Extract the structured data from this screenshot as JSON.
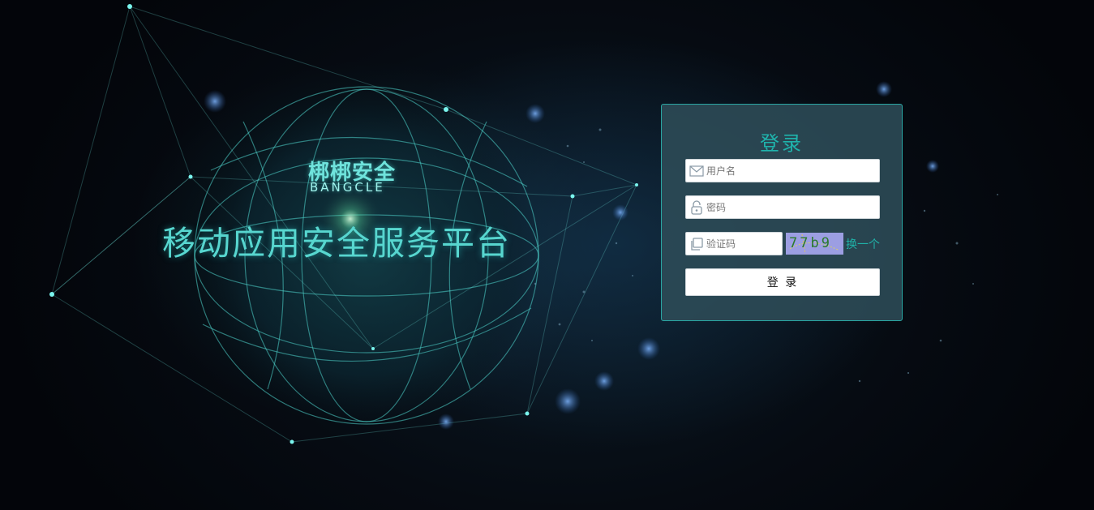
{
  "brand": {
    "name_cn": "梆梆安全",
    "name_en": "BANGCLE"
  },
  "platform_title": "移动应用安全服务平台",
  "login": {
    "title": "登录",
    "username_placeholder": "用户名",
    "password_placeholder": "密码",
    "captcha_placeholder": "验证码",
    "captcha_text": "77b9",
    "refresh_captcha_label": "换一个",
    "submit_label": "登 录"
  },
  "colors": {
    "accent": "#1fb3ac",
    "panel_border": "#2aa6a3",
    "panel_bg": "#2d4c58",
    "captcha_bg": "#9c9ee2"
  },
  "icons": {
    "username": "envelope-icon",
    "password": "lock-icon",
    "captcha": "copy-icon"
  }
}
